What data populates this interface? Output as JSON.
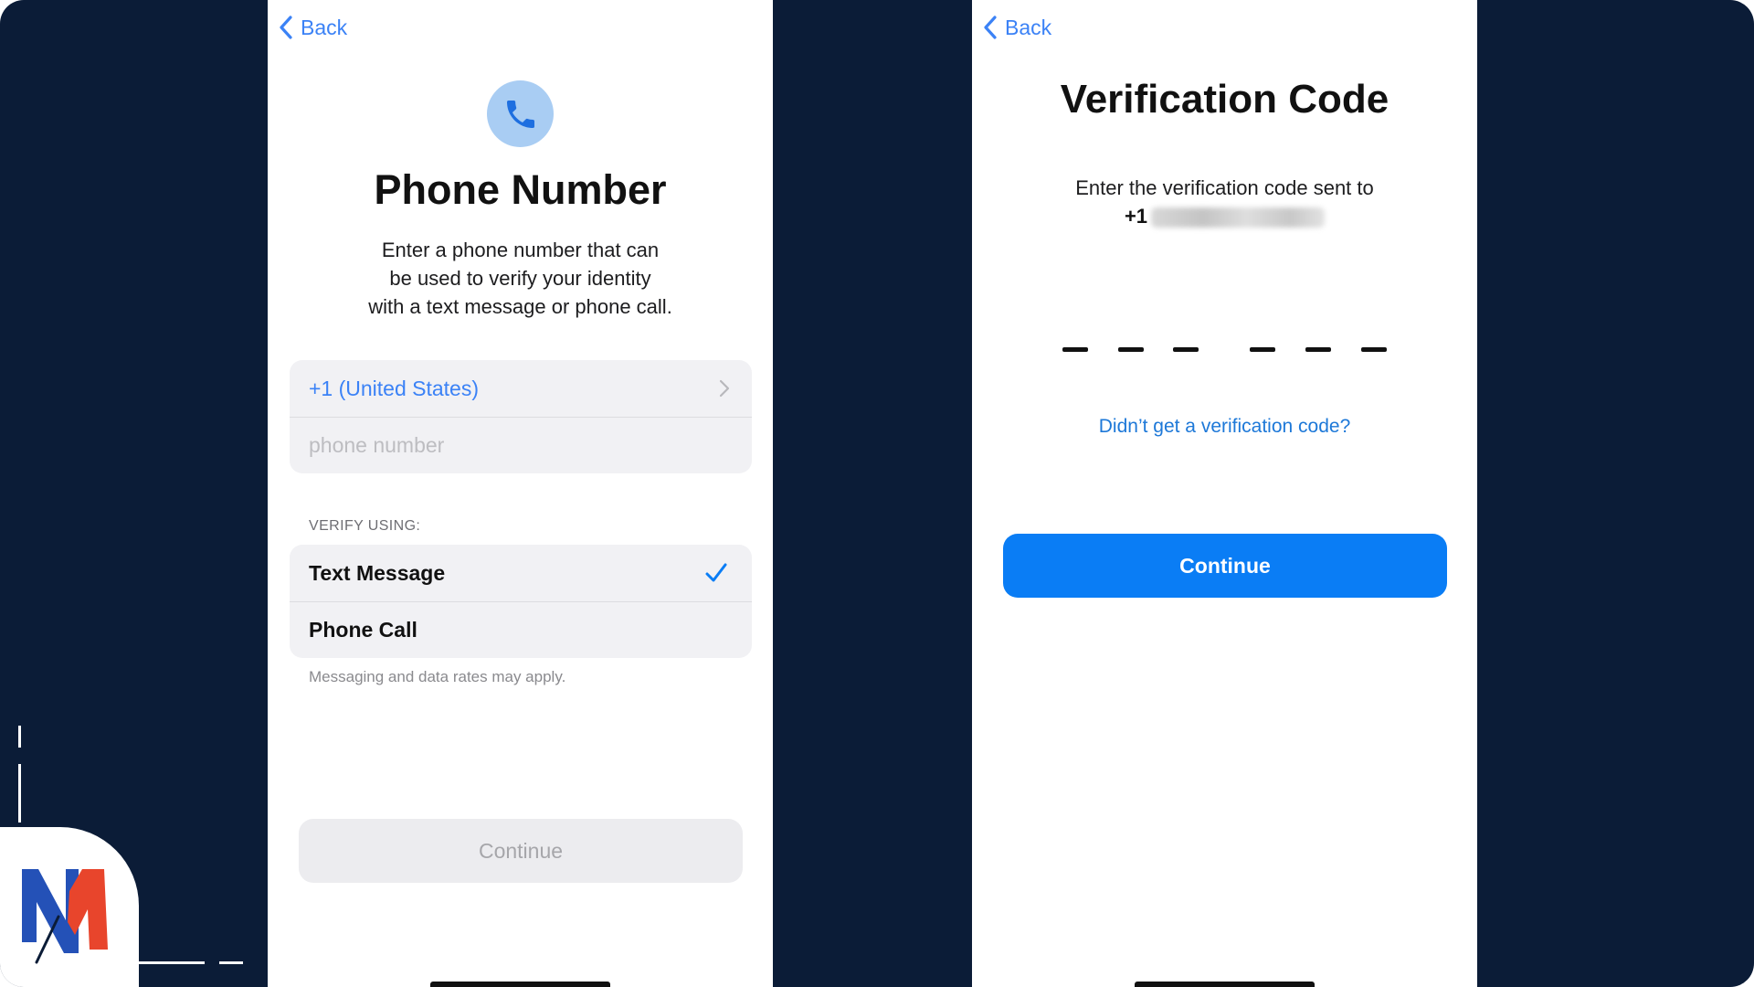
{
  "theme": {
    "background": "#0b1c37",
    "accent": "#3b82f6",
    "primary_button": "#0a7df5",
    "logo_blue": "#2451b7",
    "logo_red": "#e8452c"
  },
  "left_screen": {
    "back_label": "Back",
    "icon": "phone-icon",
    "title": "Phone Number",
    "description_lines": [
      "Enter a phone number that can",
      "be used to verify your identity",
      "with a text message or phone call."
    ],
    "country_label": "+1 (United States)",
    "phone_placeholder": "phone number",
    "phone_value": "",
    "verify_label": "VERIFY USING:",
    "options": [
      {
        "label": "Text Message",
        "selected": true
      },
      {
        "label": "Phone Call",
        "selected": false
      }
    ],
    "footnote": "Messaging and data rates may apply.",
    "continue_label": "Continue",
    "continue_enabled": false
  },
  "right_screen": {
    "back_label": "Back",
    "title": "Verification Code",
    "description_line": "Enter the verification code sent to",
    "number_prefix": "+1",
    "code_slots": 6,
    "resend_link": "Didn’t get a verification code?",
    "continue_label": "Continue",
    "continue_enabled": true
  },
  "logo": {
    "icon": "nm-logo-icon"
  }
}
